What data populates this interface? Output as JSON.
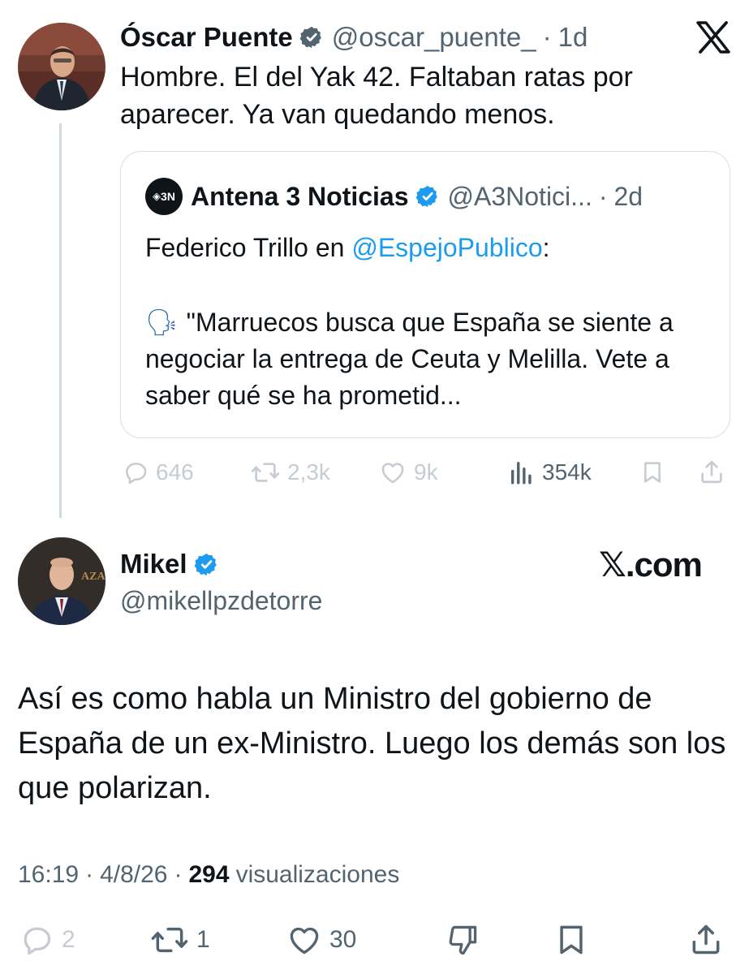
{
  "parent_tweet": {
    "author_name": "Óscar Puente",
    "handle": "@oscar_puente_",
    "separator": "·",
    "time": "1d",
    "text": "Hombre. El del Yak 42. Faltaban ratas por aparecer. Ya van quedando menos.",
    "quoted": {
      "logo_text": "3N",
      "author_name": "Antena 3 Noticias",
      "handle": "@A3Notici...",
      "separator": "·",
      "time": "2d",
      "text_prefix": "Federico Trillo en ",
      "mention": "@EspejoPublico",
      "text_suffix": ":",
      "emoji": "🗣",
      "quote_text": "\"Marruecos busca que España se siente a negociar la entrega de Ceuta y Melilla. Vete a saber qué se ha prometid..."
    },
    "stats": {
      "replies": "646",
      "reposts": "2,3k",
      "likes": "9k",
      "views": "354k"
    }
  },
  "main_tweet": {
    "author_name": "Mikel",
    "handle": "@mikellpzdetorre",
    "brand": "𝕏.com",
    "text": "Así es como habla un Ministro del gobierno de España de un ex-Ministro. Luego los demás son los que polarizan.",
    "time": "16:19",
    "separator": "·",
    "date": "4/8/26",
    "separator2": "·",
    "views_count": "294",
    "views_label": "visualizaciones",
    "stats": {
      "replies": "2",
      "reposts": "1",
      "likes": "30"
    }
  },
  "icons": {
    "x_logo": "x-logo-icon",
    "verified": "verified-badge-icon",
    "reply": "reply-icon",
    "repost": "repost-icon",
    "like": "like-icon",
    "views": "views-icon",
    "bookmark": "bookmark-icon",
    "share": "share-icon",
    "dislike": "dislike-icon"
  },
  "colors": {
    "verified_blue": "#1d9bf0",
    "text": "#0f1419",
    "muted": "#536471",
    "faded": "#c6ccd1"
  }
}
